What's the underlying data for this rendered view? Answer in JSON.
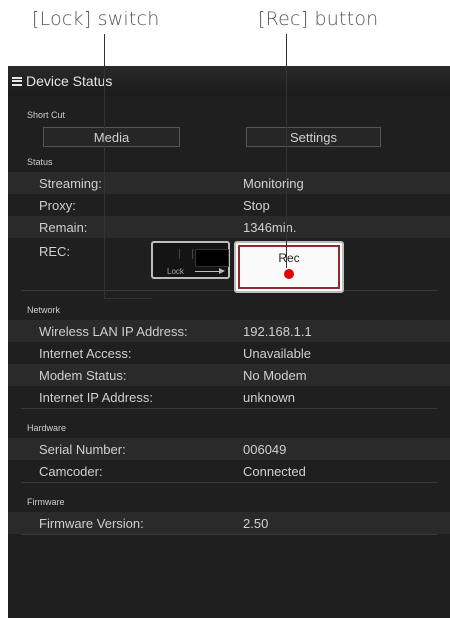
{
  "callouts": {
    "lock": "[Lock] switch",
    "rec": "[Rec] button"
  },
  "header": {
    "title": "Device Status"
  },
  "shortcut": {
    "label": "Short Cut",
    "media": "Media",
    "settings": "Settings"
  },
  "status": {
    "label": "Status",
    "rows": [
      {
        "key": "Streaming:",
        "value": "Monitoring"
      },
      {
        "key": "Proxy:",
        "value": "Stop"
      },
      {
        "key": "Remain:",
        "value": "1346min."
      }
    ],
    "rec_key": "REC:",
    "lock_label": "Lock",
    "rec_button": "Rec"
  },
  "network": {
    "label": "Network",
    "rows": [
      {
        "key": "Wireless LAN IP Address:",
        "value": "192.168.1.1"
      },
      {
        "key": "Internet Access:",
        "value": "Unavailable"
      },
      {
        "key": "Modem Status:",
        "value": "No Modem"
      },
      {
        "key": "Internet IP Address:",
        "value": "unknown"
      }
    ]
  },
  "hardware": {
    "label": "Hardware",
    "rows": [
      {
        "key": "Serial Number:",
        "value": "006049"
      },
      {
        "key": "Camcoder:",
        "value": "Connected"
      }
    ]
  },
  "firmware": {
    "label": "Firmware",
    "rows": [
      {
        "key": "Firmware Version:",
        "value": "2.50"
      }
    ]
  },
  "icons": {
    "menu": "hamburger-menu-icon",
    "rec_dot": "record-dot-icon"
  },
  "colors": {
    "background": "#1f1f1f",
    "rec_dot": "#e10000",
    "rec_border": "#8b2d2d"
  }
}
